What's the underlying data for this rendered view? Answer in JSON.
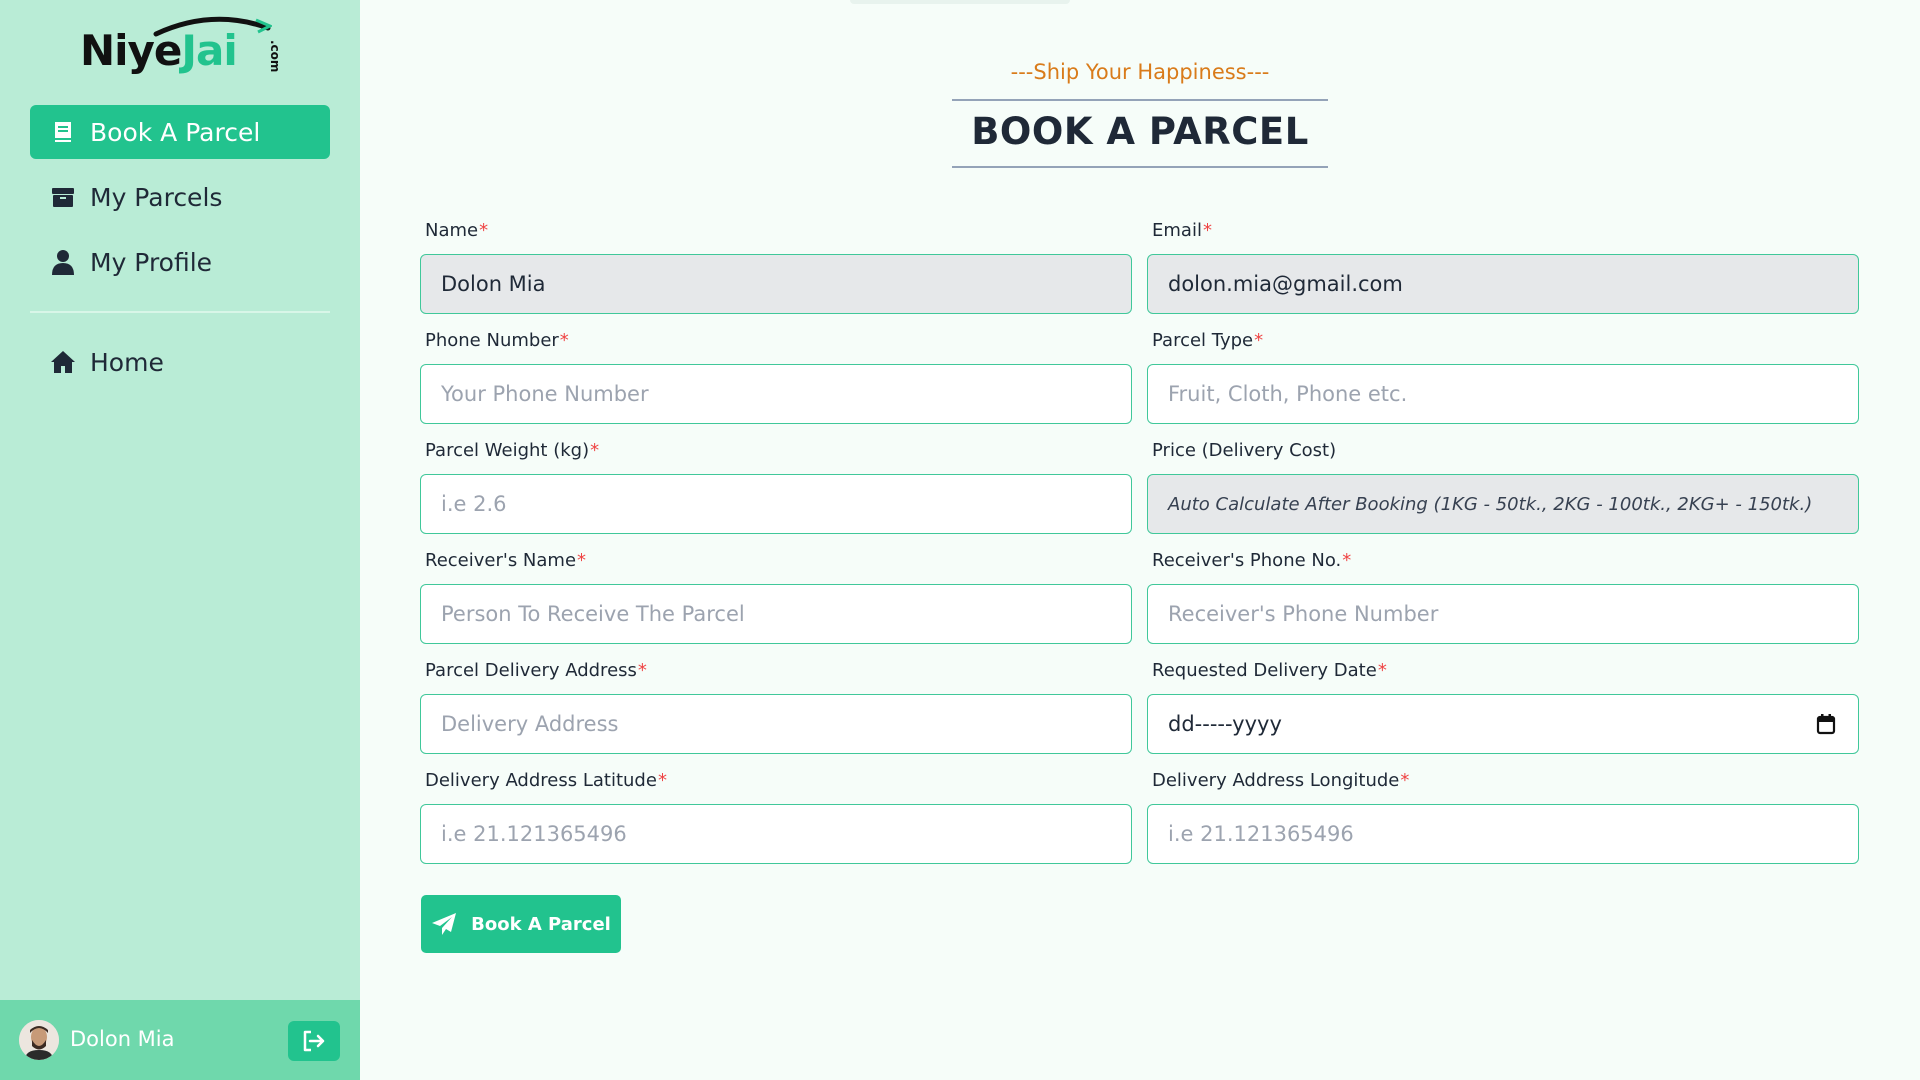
{
  "brand": {
    "name_dark": "Niye",
    "name_accent": "Jai",
    "suffix": ".com",
    "accent_color": "#22c38e"
  },
  "sidebar": {
    "items": [
      {
        "label": "Book A Parcel",
        "icon": "book-icon",
        "active": true
      },
      {
        "label": "My Parcels",
        "icon": "box-icon",
        "active": false
      },
      {
        "label": "My Profile",
        "icon": "user-icon",
        "active": false
      }
    ],
    "secondary_items": [
      {
        "label": "Home",
        "icon": "home-icon"
      }
    ]
  },
  "user": {
    "name": "Dolon Mia",
    "logout_icon": "logout-icon"
  },
  "header": {
    "tagline": "---Ship Your Happiness---",
    "title": "BOOK A PARCEL"
  },
  "form": {
    "name": {
      "label": "Name",
      "value": "Dolon Mia"
    },
    "email": {
      "label": "Email",
      "value": "dolon.mia@gmail.com"
    },
    "phone": {
      "label": "Phone Number",
      "placeholder": "Your Phone Number"
    },
    "parcel_type": {
      "label": "Parcel Type",
      "placeholder": "Fruit, Cloth, Phone etc."
    },
    "weight": {
      "label": "Parcel Weight (kg)",
      "placeholder": "i.e 2.6"
    },
    "price": {
      "label": "Price (Delivery Cost)",
      "value": "Auto Calculate After Booking (1KG - 50tk., 2KG - 100tk., 2KG+ - 150tk.)"
    },
    "receiver_name": {
      "label": "Receiver's Name",
      "placeholder": "Person To Receive The Parcel"
    },
    "receiver_phone": {
      "label": "Receiver's Phone No.",
      "placeholder": "Receiver's Phone Number"
    },
    "address": {
      "label": "Parcel Delivery Address",
      "placeholder": "Delivery Address"
    },
    "date": {
      "label": "Requested Delivery Date",
      "value": "dd-----yyyy"
    },
    "latitude": {
      "label": "Delivery Address Latitude",
      "placeholder": "i.e 21.121365496"
    },
    "longitude": {
      "label": "Delivery Address Longitude",
      "placeholder": "i.e 21.121365496"
    },
    "required_mark": "*",
    "submit_label": "Book A Parcel"
  }
}
